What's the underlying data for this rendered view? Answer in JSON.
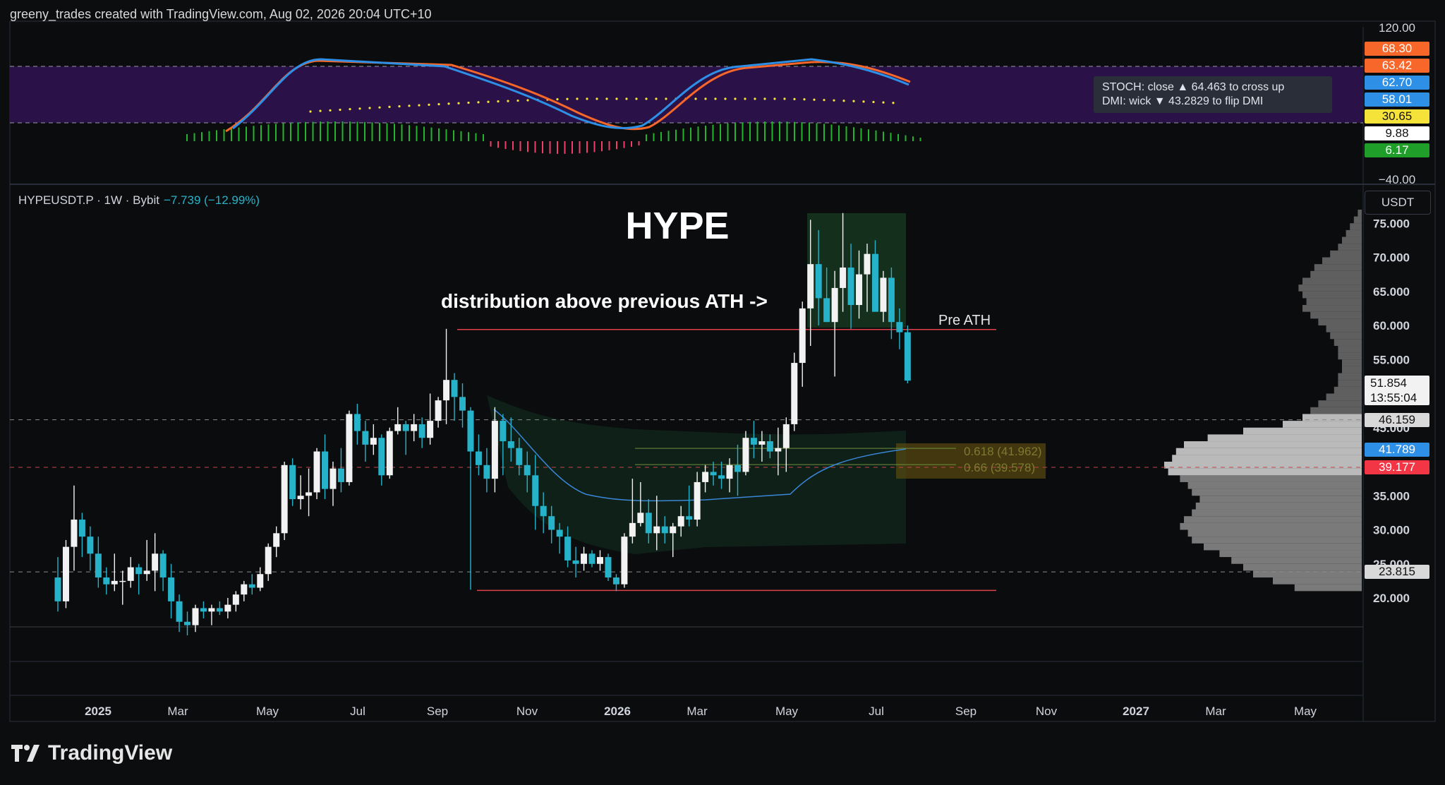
{
  "header": {
    "text": "greeny_trades created with TradingView.com, Aug 02, 2026 20:04 UTC+10"
  },
  "symbol": {
    "name": "HYPEUSDT.P · 1W · Bybit",
    "change": "−7.739 (−12.99%)"
  },
  "unit": "USDT",
  "tooltip": {
    "line1": "STOCH: close ▲ 64.463 to cross up",
    "line2": "DMI: wick ▼ 43.2829 to flip DMI"
  },
  "logo": "TradingView",
  "indicator_badges": [
    {
      "label": "68.30",
      "bg": "#f7672a",
      "fg": "#ffffff"
    },
    {
      "label": "63.42",
      "bg": "#f7672a",
      "fg": "#ffffff"
    },
    {
      "label": "62.70",
      "bg": "#2e8fe6",
      "fg": "#ffffff"
    },
    {
      "label": "58.01",
      "bg": "#2e8fe6",
      "fg": "#ffffff"
    },
    {
      "label": "30.65",
      "bg": "#f6e33a",
      "fg": "#111111"
    },
    {
      "label": "9.88",
      "bg": "#ffffff",
      "fg": "#111111"
    },
    {
      "label": "6.17",
      "bg": "#1f9f2a",
      "fg": "#ffffff"
    }
  ],
  "indicator_ticks": [
    "120.00",
    "−40.00"
  ],
  "last_price": {
    "price": "51.854",
    "countdown": "13:55:04"
  },
  "price_badges": [
    {
      "value": 46.159,
      "label": "46.159",
      "bg": "#d9d9d9",
      "fg": "#111111"
    },
    {
      "value": 41.789,
      "label": "41.789",
      "bg": "#2e8fe6",
      "fg": "#ffffff"
    },
    {
      "value": 39.177,
      "label": "39.177",
      "bg": "#f23645",
      "fg": "#ffffff"
    },
    {
      "value": 23.815,
      "label": "23.815",
      "bg": "#d9d9d9",
      "fg": "#111111"
    }
  ],
  "annotations": {
    "title": "HYPE",
    "note": "distribution above previous ATH ->",
    "pre_ath": "Pre ATH",
    "fib1": "0.618 (41.962)",
    "fib2": "0.66 (39.578)"
  },
  "chart_data": {
    "type": "candlestick",
    "y_ticks": [
      "75.000",
      "70.000",
      "65.000",
      "60.000",
      "55.000",
      "45.000",
      "35.000",
      "30.000",
      "25.000",
      "20.000"
    ],
    "x_ticks": [
      "2025",
      "Mar",
      "May",
      "Jul",
      "Sep",
      "Nov",
      "2026",
      "Mar",
      "May",
      "Jul",
      "Sep",
      "Nov",
      "2027",
      "Mar",
      "May"
    ],
    "levels": {
      "pre_ath": 59.4,
      "range_low": 21.1
    },
    "candles": [
      [
        23.0,
        26.0,
        18.0,
        19.5
      ],
      [
        19.5,
        28.5,
        18.5,
        27.5
      ],
      [
        27.5,
        36.5,
        24.0,
        31.5
      ],
      [
        31.5,
        32.5,
        26.0,
        29.0
      ],
      [
        29.0,
        30.5,
        24.0,
        26.5
      ],
      [
        26.5,
        29.0,
        21.5,
        23.0
      ],
      [
        23.0,
        24.5,
        20.5,
        22.0
      ],
      [
        22.0,
        26.5,
        21.0,
        22.5
      ],
      [
        22.5,
        24.0,
        19.0,
        22.5
      ],
      [
        22.5,
        26.0,
        21.5,
        24.5
      ],
      [
        24.5,
        25.0,
        20.5,
        23.5
      ],
      [
        23.5,
        28.5,
        22.5,
        24.0
      ],
      [
        24.0,
        29.5,
        21.0,
        26.5
      ],
      [
        26.5,
        27.0,
        21.0,
        23.0
      ],
      [
        23.0,
        25.0,
        17.0,
        19.5
      ],
      [
        19.5,
        20.5,
        15.0,
        16.5
      ],
      [
        16.5,
        18.0,
        14.5,
        16.0
      ],
      [
        16.0,
        19.0,
        15.0,
        18.5
      ],
      [
        18.5,
        19.5,
        17.0,
        18.0
      ],
      [
        18.0,
        19.0,
        16.0,
        18.5
      ],
      [
        18.5,
        19.5,
        17.5,
        18.0
      ],
      [
        18.0,
        20.0,
        17.0,
        19.0
      ],
      [
        19.0,
        21.0,
        18.0,
        20.5
      ],
      [
        20.5,
        22.5,
        19.5,
        22.0
      ],
      [
        22.0,
        23.5,
        20.5,
        21.5
      ],
      [
        21.5,
        24.5,
        21.0,
        23.5
      ],
      [
        23.5,
        28.0,
        22.5,
        27.5
      ],
      [
        27.5,
        30.5,
        26.0,
        29.5
      ],
      [
        29.5,
        40.0,
        28.5,
        39.5
      ],
      [
        39.5,
        40.5,
        33.5,
        34.5
      ],
      [
        34.5,
        38.0,
        33.0,
        35.0
      ],
      [
        35.0,
        39.0,
        32.0,
        35.5
      ],
      [
        35.5,
        42.0,
        34.5,
        41.5
      ],
      [
        41.5,
        44.0,
        34.5,
        36.0
      ],
      [
        36.0,
        40.0,
        33.5,
        39.0
      ],
      [
        39.0,
        42.0,
        35.5,
        37.0
      ],
      [
        37.0,
        47.5,
        36.5,
        47.0
      ],
      [
        47.0,
        48.5,
        42.5,
        44.5
      ],
      [
        44.5,
        46.0,
        40.0,
        42.5
      ],
      [
        42.5,
        45.5,
        41.0,
        43.5
      ],
      [
        43.5,
        44.0,
        36.5,
        38.0
      ],
      [
        38.0,
        45.0,
        37.5,
        44.5
      ],
      [
        44.5,
        48.0,
        44.0,
        45.5
      ],
      [
        45.5,
        46.0,
        41.0,
        44.5
      ],
      [
        44.5,
        47.0,
        43.0,
        45.5
      ],
      [
        45.5,
        46.5,
        42.0,
        43.5
      ],
      [
        43.5,
        50.0,
        42.5,
        46.0
      ],
      [
        46.0,
        49.5,
        45.0,
        49.0
      ],
      [
        49.0,
        59.5,
        45.5,
        52.0
      ],
      [
        52.0,
        53.0,
        46.0,
        49.5
      ],
      [
        49.5,
        51.5,
        45.0,
        47.5
      ],
      [
        47.5,
        48.0,
        21.2,
        41.5
      ],
      [
        41.5,
        44.0,
        38.0,
        39.5
      ],
      [
        39.5,
        42.0,
        35.5,
        37.5
      ],
      [
        37.5,
        48.0,
        35.5,
        46.0
      ],
      [
        46.0,
        47.0,
        38.0,
        43.0
      ],
      [
        43.0,
        46.5,
        40.0,
        42.0
      ],
      [
        42.0,
        43.5,
        38.0,
        39.5
      ],
      [
        39.5,
        41.5,
        35.5,
        38.0
      ],
      [
        38.0,
        41.0,
        30.0,
        33.5
      ],
      [
        33.5,
        35.5,
        29.5,
        32.0
      ],
      [
        32.0,
        33.5,
        28.0,
        30.0
      ],
      [
        30.0,
        31.0,
        26.5,
        29.0
      ],
      [
        29.0,
        30.5,
        24.5,
        25.5
      ],
      [
        25.5,
        27.5,
        23.0,
        25.0
      ],
      [
        25.0,
        27.5,
        24.0,
        26.5
      ],
      [
        26.5,
        27.0,
        24.5,
        25.0
      ],
      [
        25.0,
        27.0,
        24.0,
        26.0
      ],
      [
        26.0,
        26.5,
        22.5,
        23.0
      ],
      [
        23.0,
        23.5,
        21.0,
        22.0
      ],
      [
        22.0,
        29.5,
        21.5,
        29.0
      ],
      [
        29.0,
        37.5,
        28.0,
        31.0
      ],
      [
        31.0,
        37.0,
        30.5,
        32.5
      ],
      [
        32.5,
        34.5,
        28.0,
        29.5
      ],
      [
        29.5,
        35.0,
        27.0,
        30.5
      ],
      [
        30.5,
        32.0,
        28.0,
        29.5
      ],
      [
        29.5,
        31.0,
        26.0,
        30.5
      ],
      [
        30.5,
        33.5,
        29.0,
        32.0
      ],
      [
        32.0,
        36.5,
        30.5,
        31.5
      ],
      [
        31.5,
        38.5,
        30.5,
        37.0
      ],
      [
        37.0,
        39.5,
        35.5,
        38.5
      ],
      [
        38.5,
        40.0,
        36.5,
        38.0
      ],
      [
        38.0,
        40.0,
        36.0,
        37.5
      ],
      [
        37.5,
        40.5,
        35.5,
        39.5
      ],
      [
        39.5,
        42.5,
        35.0,
        38.5
      ],
      [
        38.5,
        44.5,
        38.0,
        43.5
      ],
      [
        43.5,
        46.0,
        40.5,
        42.5
      ],
      [
        42.5,
        44.5,
        40.0,
        43.0
      ],
      [
        43.0,
        44.0,
        40.5,
        41.5
      ],
      [
        41.5,
        45.0,
        38.0,
        42.0
      ],
      [
        42.0,
        46.5,
        38.5,
        45.5
      ],
      [
        45.5,
        56.0,
        44.5,
        54.5
      ],
      [
        54.5,
        63.5,
        51.0,
        62.5
      ],
      [
        62.5,
        75.5,
        57.0,
        69.0
      ],
      [
        69.0,
        74.0,
        60.0,
        64.0
      ],
      [
        64.0,
        68.5,
        60.5,
        60.5
      ],
      [
        60.5,
        68.0,
        52.5,
        65.5
      ],
      [
        65.5,
        76.5,
        62.0,
        68.5
      ],
      [
        68.5,
        72.0,
        59.5,
        63.0
      ],
      [
        63.0,
        71.0,
        61.0,
        67.5
      ],
      [
        67.5,
        72.0,
        62.0,
        70.5
      ],
      [
        70.5,
        72.5,
        63.5,
        62.0
      ],
      [
        62.0,
        68.0,
        60.5,
        67.0
      ],
      [
        67.0,
        68.5,
        58.0,
        60.5
      ],
      [
        60.5,
        62.5,
        56.5,
        59.0
      ],
      [
        59.0,
        60.0,
        51.5,
        51.9
      ]
    ],
    "profile_bins": [
      [
        21,
        0.34
      ],
      [
        22,
        0.45
      ],
      [
        23,
        0.55
      ],
      [
        24,
        0.6
      ],
      [
        25,
        0.66
      ],
      [
        26,
        0.72
      ],
      [
        27,
        0.8
      ],
      [
        28,
        0.86
      ],
      [
        29,
        0.88
      ],
      [
        30,
        0.92
      ],
      [
        31,
        0.9
      ],
      [
        32,
        0.86
      ],
      [
        33,
        0.84
      ],
      [
        34,
        0.82
      ],
      [
        35,
        0.86
      ],
      [
        36,
        0.88
      ],
      [
        37,
        0.92
      ],
      [
        38,
        0.98
      ],
      [
        39,
        1.0
      ],
      [
        40,
        0.96
      ],
      [
        41,
        0.94
      ],
      [
        42,
        0.9
      ],
      [
        43,
        0.78
      ],
      [
        44,
        0.6
      ],
      [
        45,
        0.4
      ],
      [
        46,
        0.3
      ],
      [
        47,
        0.26
      ],
      [
        48,
        0.22
      ],
      [
        49,
        0.18
      ],
      [
        50,
        0.14
      ],
      [
        51,
        0.12
      ],
      [
        52,
        0.12
      ],
      [
        53,
        0.1
      ],
      [
        54,
        0.1
      ],
      [
        55,
        0.12
      ],
      [
        56,
        0.12
      ],
      [
        57,
        0.14
      ],
      [
        58,
        0.16
      ],
      [
        59,
        0.18
      ],
      [
        60,
        0.22
      ],
      [
        61,
        0.26
      ],
      [
        62,
        0.3
      ],
      [
        63,
        0.28
      ],
      [
        64,
        0.3
      ],
      [
        65,
        0.32
      ],
      [
        66,
        0.3
      ],
      [
        67,
        0.26
      ],
      [
        68,
        0.24
      ],
      [
        69,
        0.2
      ],
      [
        70,
        0.16
      ],
      [
        71,
        0.12
      ],
      [
        72,
        0.1
      ],
      [
        73,
        0.08
      ],
      [
        74,
        0.06
      ],
      [
        75,
        0.04
      ],
      [
        76,
        0.02
      ]
    ]
  }
}
